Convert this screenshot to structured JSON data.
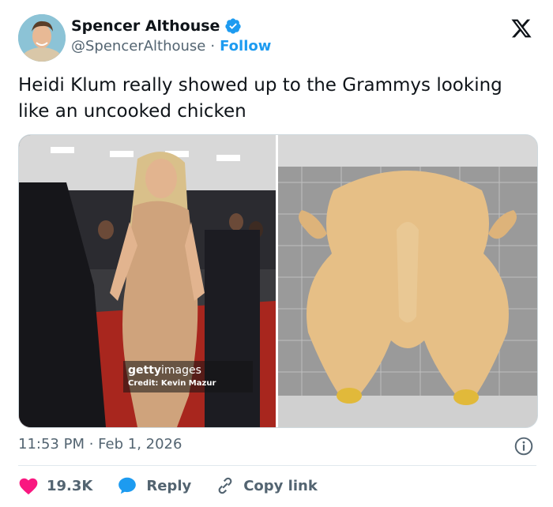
{
  "author": {
    "name": "Spencer Althouse",
    "handle": "@SpencerAlthouse",
    "separator": "·",
    "follow_label": "Follow"
  },
  "tweet": {
    "text": "Heidi Klum really showed up to the Grammys looking like an uncooked chicken"
  },
  "media": {
    "watermark_brand": "getty",
    "watermark_suffix": "images",
    "credit": "Credit: Kevin Mazur"
  },
  "meta": {
    "timestamp": "11:53 PM · Feb 1, 2026"
  },
  "actions": {
    "likes": "19.3K",
    "reply_label": "Reply",
    "copy_link_label": "Copy link"
  },
  "colors": {
    "accent": "#1d9bf0",
    "like": "#f91880",
    "text": "#0f1419",
    "muted": "#536471"
  },
  "icons": [
    "verified-badge-icon",
    "x-logo-icon",
    "info-icon",
    "heart-icon",
    "reply-bubble-icon",
    "link-icon"
  ]
}
